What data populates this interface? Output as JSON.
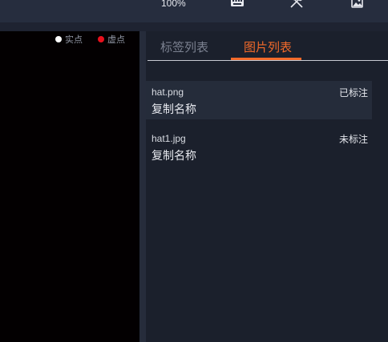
{
  "toolbar": {
    "zoom": "100%",
    "icons": [
      "keyboard-icon",
      "tools-icon",
      "image-icon"
    ],
    "background": "#262d3e"
  },
  "canvas": {
    "legend": {
      "real_point": "实点",
      "virtual_point": "虚点"
    },
    "colors": {
      "background": "#030001",
      "real_point": "#ffffff",
      "virtual_point": "#e8101c"
    }
  },
  "panel": {
    "tabs": [
      {
        "label": "标签列表",
        "active": false
      },
      {
        "label": "图片列表",
        "active": true
      }
    ],
    "accent": "#f26a2a",
    "images": [
      {
        "filename": "hat.png",
        "status": "已标注",
        "action": "复制名称",
        "selected": true
      },
      {
        "filename": "hat1.jpg",
        "status": "未标注",
        "action": "复制名称",
        "selected": false
      }
    ]
  }
}
